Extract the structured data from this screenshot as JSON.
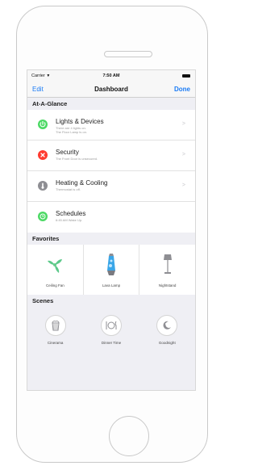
{
  "status": {
    "carrier": "Carrier",
    "wifi_icon": "wifi-icon",
    "time": "7:50 AM"
  },
  "nav": {
    "edit": "Edit",
    "title": "Dashboard",
    "done": "Done"
  },
  "glance": {
    "header": "At-A-Glance",
    "items": [
      {
        "title": "Lights & Devices",
        "sub": "There are 4 lights on.\nThe Floor Lamp is on.",
        "icon": "power-icon",
        "color": "#4cd964",
        "has_chevron": true
      },
      {
        "title": "Security",
        "sub": "The Front Door is unsecured.",
        "icon": "alert-icon",
        "color": "#ff3b30",
        "has_chevron": true
      },
      {
        "title": "Heating & Cooling",
        "sub": "Thermostat is off.",
        "icon": "thermostat-icon",
        "color": "#8e8e93",
        "has_chevron": true
      },
      {
        "title": "Schedules",
        "sub": "6:45 AM Wake Up.",
        "icon": "clock-icon",
        "color": "#4cd964",
        "has_chevron": false
      }
    ],
    "chevron": ">"
  },
  "favorites": {
    "header": "Favorites",
    "items": [
      {
        "label": "Ceiling Fan",
        "icon": "fan-icon"
      },
      {
        "label": "Lava Lamp",
        "icon": "lava-lamp-icon"
      },
      {
        "label": "Nightstand",
        "icon": "table-lamp-icon"
      }
    ]
  },
  "scenes": {
    "header": "Scenes",
    "items": [
      {
        "label": "Cinerama",
        "icon": "popcorn-icon"
      },
      {
        "label": "Dinner Time",
        "icon": "plate-icon"
      },
      {
        "label": "Goodnight",
        "icon": "moon-icon"
      }
    ]
  }
}
